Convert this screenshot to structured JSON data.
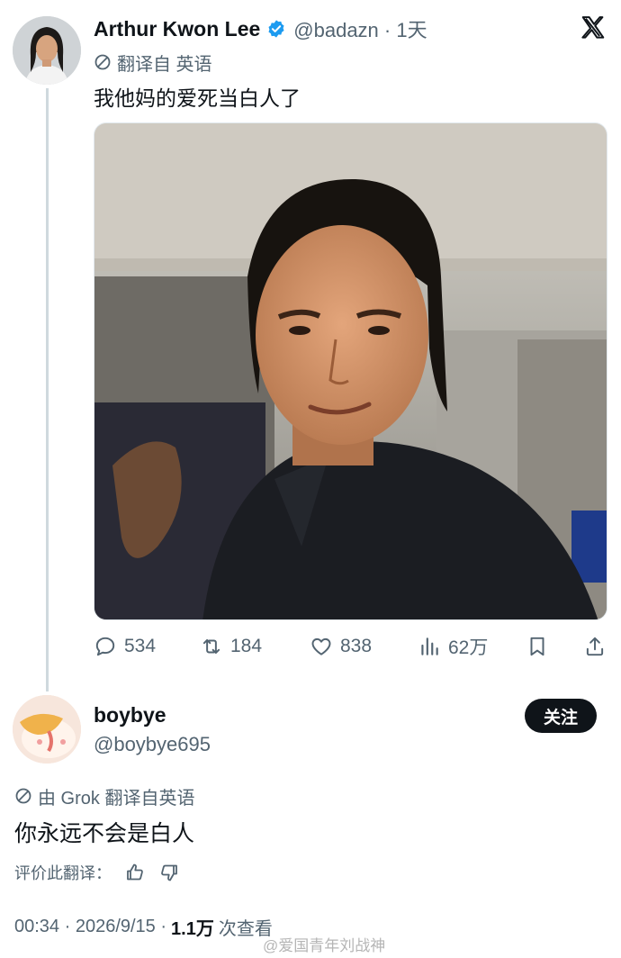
{
  "tweet": {
    "author_name": "Arthur Kwon Lee",
    "verified_icon": "verified-badge-icon",
    "handle_time": "@badazn · 1天",
    "translated_label": "翻译自 英语",
    "text": "我他妈的爱死当白人了",
    "actions": {
      "replies": "534",
      "retweets": "184",
      "likes": "838",
      "views": "62万"
    }
  },
  "reply": {
    "author_name": "boybye",
    "handle": "@boybye695",
    "follow_label": "关注",
    "translated_label": "由 Grok 翻译自英语",
    "text": "你永远不会是白人",
    "rate_label": "评价此翻译：",
    "meta_time": "00:34 · 2026/9/15 ·",
    "meta_views": "1.1万",
    "meta_views_suffix": "次查看"
  },
  "watermark": "@爱国青年刘战神",
  "colors": {
    "accent": "#1d9bf0",
    "text_primary": "#0f1419",
    "text_secondary": "#536471",
    "thread_line": "#cfd9de"
  }
}
